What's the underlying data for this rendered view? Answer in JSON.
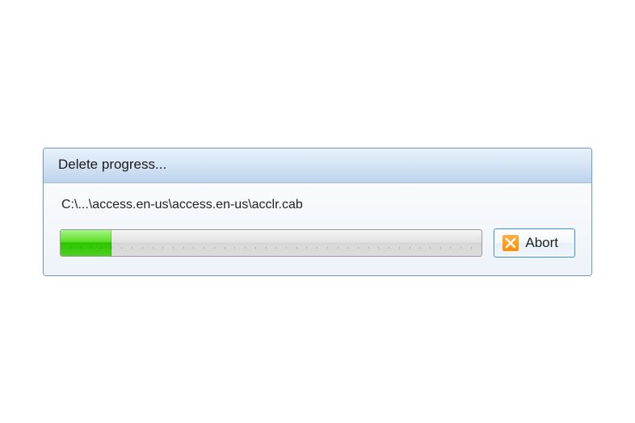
{
  "dialog": {
    "title": "Delete progress...",
    "filepath": "C:\\...\\access.en-us\\access.en-us\\acclr.cab",
    "progress_percent": 12,
    "abort_label": "Abort"
  }
}
